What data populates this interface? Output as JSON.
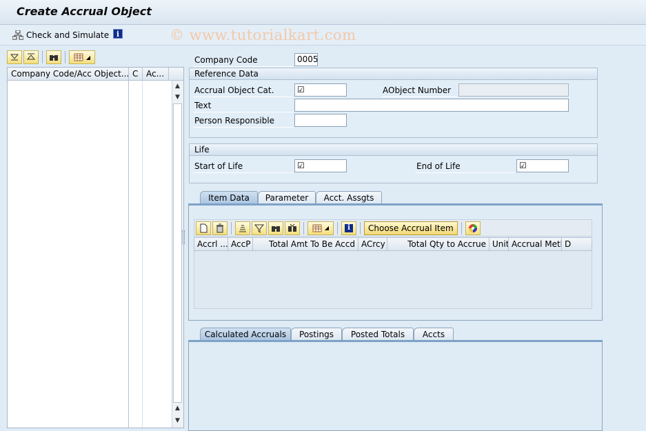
{
  "title": "Create Accrual Object",
  "toolbar": {
    "check_simulate": "Check and Simulate",
    "info_icon": "info-icon"
  },
  "watermark": "© www.tutorialkart.com",
  "left_panel": {
    "columns": [
      "Company Code/Acc Object...",
      "C",
      "Ac..."
    ]
  },
  "form": {
    "company_code_label": "Company Code",
    "company_code_value": "0005",
    "reference_data": {
      "title": "Reference Data",
      "accrual_object_cat_label": "Accrual Object Cat.",
      "aobject_number_label": "AObject Number",
      "text_label": "Text",
      "person_responsible_label": "Person Responsible"
    },
    "life": {
      "title": "Life",
      "start_label": "Start of Life",
      "end_label": "End of Life"
    }
  },
  "tabs_top": [
    "Item Data",
    "Parameter",
    "Acct. Assgts"
  ],
  "item_grid": {
    "choose_button": "Choose Accrual Item",
    "columns": [
      "Accrl ...",
      "AccP",
      "Total Amt To Be Accd",
      "ACrcy",
      "Total Qty to Accrue",
      "Unit",
      "Accrual Meth",
      "D"
    ]
  },
  "tabs_bottom": [
    "Calculated Accruals",
    "Postings",
    "Posted Totals",
    "Accts"
  ]
}
